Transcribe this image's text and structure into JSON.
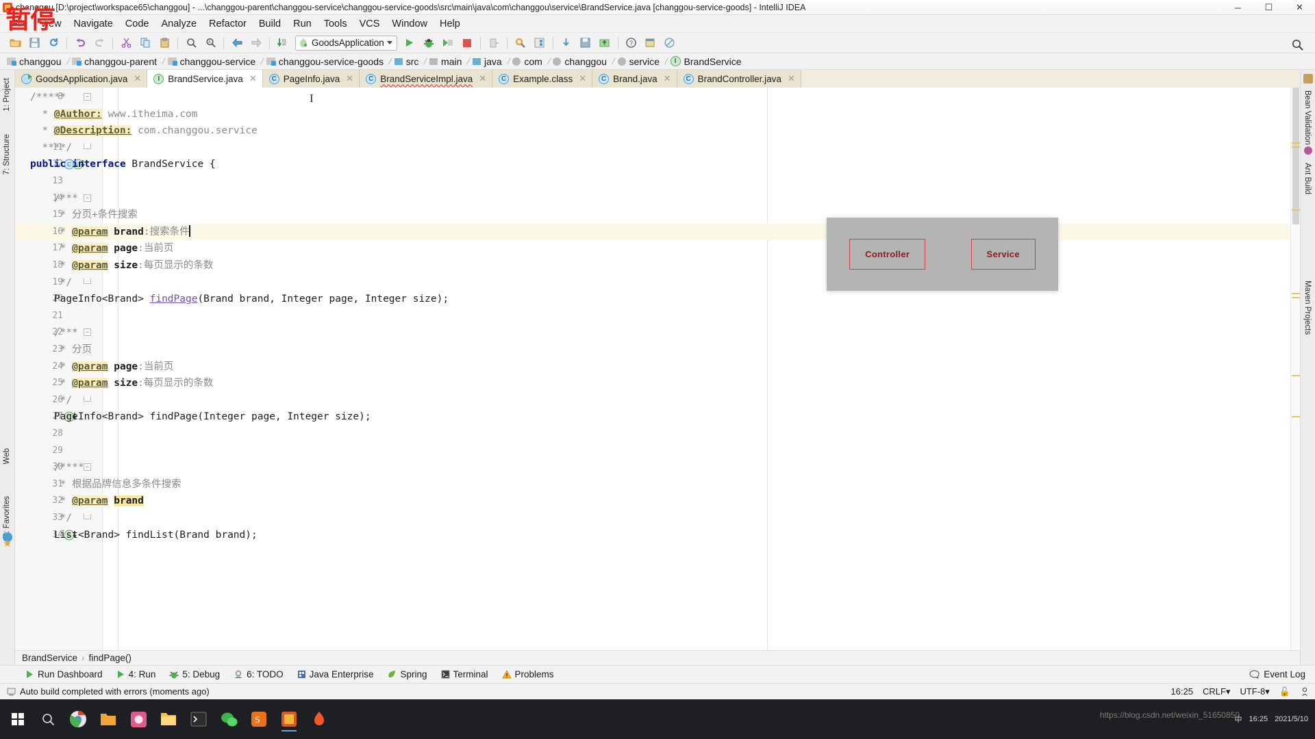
{
  "window": {
    "title": "changgou [D:\\project\\workspace65\\changgou] - ...\\changgou-parent\\changgou-service\\changgou-service-goods\\src\\main\\java\\com\\changgou\\service\\BrandService.java [changgou-service-goods] - IntelliJ IDEA",
    "minimize": "─",
    "maximize": "☐",
    "close": "✕",
    "watermark": "暂停",
    "bottom_watermark": "https://blog.csdn.net/weixin_51650850"
  },
  "menubar": {
    "items": [
      "File",
      "View",
      "Navigate",
      "Code",
      "Analyze",
      "Refactor",
      "Build",
      "Run",
      "Tools",
      "VCS",
      "Window",
      "Help"
    ]
  },
  "toolbar": {
    "open_label": "open-folder",
    "save_label": "save-all",
    "sync_label": "synchronize",
    "undo_label": "undo",
    "redo_label": "redo",
    "cut_label": "cut",
    "copy_label": "copy",
    "paste_label": "paste",
    "find_label": "find",
    "replace_label": "replace",
    "back_label": "back",
    "forward_label": "forward",
    "compile_label": "compile",
    "run_config": "GoodsApplication",
    "run_label": "Run",
    "debug_label": "Debug",
    "coverage_label": "Run with Coverage",
    "stop_label": "Stop",
    "exit_label": "exit",
    "settings_label": "Settings",
    "project_structure_label": "Project Structure",
    "update_label": "Update Project",
    "commit_label": "Commit",
    "push_label": "Push",
    "help_label": "Help",
    "search_label": "Search Everywhere"
  },
  "breadcrumb": {
    "items": [
      {
        "label": "changgou",
        "icon": "project-folder-icon"
      },
      {
        "label": "changgou-parent",
        "icon": "module-folder-icon"
      },
      {
        "label": "changgou-service",
        "icon": "module-folder-icon"
      },
      {
        "label": "changgou-service-goods",
        "icon": "module-folder-icon"
      },
      {
        "label": "src",
        "icon": "source-folder-icon"
      },
      {
        "label": "main",
        "icon": "folder-icon"
      },
      {
        "label": "java",
        "icon": "folder-icon"
      },
      {
        "label": "com",
        "icon": "package-icon"
      },
      {
        "label": "changgou",
        "icon": "package-icon"
      },
      {
        "label": "service",
        "icon": "package-icon"
      },
      {
        "label": "BrandService",
        "icon": "interface-icon"
      }
    ],
    "separator": "❯"
  },
  "tabs": [
    {
      "label": "GoodsApplication.java",
      "icon": "run-class-icon",
      "active": false,
      "error": false
    },
    {
      "label": "BrandService.java",
      "icon": "interface-icon",
      "active": true,
      "error": false
    },
    {
      "label": "PageInfo.java",
      "icon": "class-locked-icon",
      "active": false,
      "error": false
    },
    {
      "label": "BrandServiceImpl.java",
      "icon": "class-icon",
      "active": false,
      "error": true
    },
    {
      "label": "Example.class",
      "icon": "class-locked-icon",
      "active": false,
      "error": false
    },
    {
      "label": "Brand.java",
      "icon": "class-icon",
      "active": false,
      "error": false
    },
    {
      "label": "BrandController.java",
      "icon": "class-icon",
      "active": false,
      "error": false
    }
  ],
  "left_strip": [
    {
      "label": "1: Project",
      "icon": "project-icon"
    },
    {
      "label": "7: Structure",
      "icon": "structure-icon"
    },
    {
      "label": "Web",
      "icon": "web-icon"
    },
    {
      "label": "2: Favorites",
      "icon": "favorites-icon"
    }
  ],
  "right_strip": [
    {
      "label": "Bean Validation",
      "icon": "bean-icon"
    },
    {
      "label": "Ant Build",
      "icon": "ant-icon"
    },
    {
      "label": "Maven Projects",
      "icon": "maven-icon"
    }
  ],
  "editor": {
    "lines": [
      {
        "n": 8,
        "fold": "start",
        "html": "<span class='cmt'>/*****</span>"
      },
      {
        "n": 9,
        "html": "<span class='cmt'>  * </span><span class='tag'>@Author:</span><span class='tagv'> www.itheima.com</span>"
      },
      {
        "n": 10,
        "html": "<span class='cmt'>  * </span><span class='tag'>@Description:</span><span class='tagv'> com.changgou.service</span>"
      },
      {
        "n": 11,
        "fold": "end",
        "html": "<span class='cmt'>  ****/</span>"
      },
      {
        "n": 12,
        "gutter": "impl-marker",
        "html": "<span class='kw'>public interface</span> BrandService {"
      },
      {
        "n": 13,
        "html": ""
      },
      {
        "n": 14,
        "fold": "start",
        "html": "<span class='cmt'>    /***</span>"
      },
      {
        "n": 15,
        "html": "<span class='cmt'>     * 分页+条件搜索</span>"
      },
      {
        "n": 16,
        "highlight": true,
        "bulb": true,
        "caret": true,
        "html": "<span class='cmt'>     * </span><span class='tag'>@param</span> <span style='font-weight:bold'>brand</span><span class='cmt'>:搜索条件</span>"
      },
      {
        "n": 17,
        "html": "<span class='cmt'>     * </span><span class='tag'>@param</span> <span style='font-weight:bold'>page</span><span class='cmt'>:当前页</span>"
      },
      {
        "n": 18,
        "html": "<span class='cmt'>     * </span><span class='tag'>@param</span> <span style='font-weight:bold'>size</span><span class='cmt'>:每页显示的条数</span>"
      },
      {
        "n": 19,
        "fold": "end",
        "html": "<span class='cmt'>     */</span>"
      },
      {
        "n": 20,
        "html": "    PageInfo&lt;Brand&gt; <span class='mth'>findPage</span>(Brand brand, Integer page, Integer size);"
      },
      {
        "n": 21,
        "html": ""
      },
      {
        "n": 22,
        "fold": "start",
        "html": "<span class='cmt'>    /***</span>"
      },
      {
        "n": 23,
        "html": "<span class='cmt'>     * 分页</span>"
      },
      {
        "n": 24,
        "html": "<span class='cmt'>     * </span><span class='tag'>@param</span> <span style='font-weight:bold'>page</span><span class='cmt'>:当前页</span>"
      },
      {
        "n": 25,
        "html": "<span class='cmt'>     * </span><span class='tag'>@param</span> <span style='font-weight:bold'>size</span><span class='cmt'>:每页显示的条数</span>"
      },
      {
        "n": 26,
        "fold": "end",
        "html": "<span class='cmt'>     */</span>"
      },
      {
        "n": 27,
        "gutter": "impl-marker",
        "html": "    PageInfo&lt;Brand&gt; findPage(Integer page, Integer size);"
      },
      {
        "n": 28,
        "html": ""
      },
      {
        "n": 29,
        "html": ""
      },
      {
        "n": 30,
        "fold": "start",
        "html": "<span class='cmt'>    /****</span>"
      },
      {
        "n": 31,
        "html": "<span class='cmt'>     * 根据品牌信息多条件搜索</span>"
      },
      {
        "n": 32,
        "html": "<span class='cmt'>     * </span><span class='tag'>@param</span> <span class='hlword' style='font-weight:bold'>brand</span>"
      },
      {
        "n": 33,
        "fold": "end",
        "html": "<span class='cmt'>     */</span>"
      },
      {
        "n": 34,
        "gutter": "impl-marker",
        "html": "    List&lt;Brand&gt; findList(Brand brand);"
      }
    ]
  },
  "overlay": {
    "boxes": [
      "Controller",
      "Service"
    ],
    "accent": "#d04040",
    "background": "#b4b4b4"
  },
  "nav_footer": {
    "class": "BrandService",
    "member": "findPage()",
    "separator": "›"
  },
  "tool_windows": [
    {
      "label": "Run Dashboard",
      "icon": "run-dashboard-icon"
    },
    {
      "label": "4: Run",
      "icon": "run-icon"
    },
    {
      "label": "5: Debug",
      "icon": "debug-icon"
    },
    {
      "label": "6: TODO",
      "icon": "todo-icon"
    },
    {
      "label": "Java Enterprise",
      "icon": "java-enterprise-icon"
    },
    {
      "label": "Spring",
      "icon": "spring-icon"
    },
    {
      "label": "Terminal",
      "icon": "terminal-icon"
    },
    {
      "label": "Problems",
      "icon": "problems-icon"
    }
  ],
  "event_log": {
    "label": "Event Log",
    "icon": "balloon-icon"
  },
  "statusbar": {
    "message": "Auto build completed with errors (moments ago)",
    "time": "16:25",
    "line_separator": "CRLF",
    "encoding": "UTF-8",
    "lock_icon": "lock-icon",
    "inspection_icon": "inspector-icon"
  },
  "taskbar": {
    "start_icon": "windows-start-icon",
    "search_icon": "search-circle-icon",
    "apps": [
      {
        "name": "chrome-taskbar-icon",
        "color": "#e8e8e8"
      },
      {
        "name": "folder-orange-taskbar-icon",
        "color": "#f0a43a"
      },
      {
        "name": "photos-taskbar-icon",
        "color": "#e05a8a"
      },
      {
        "name": "explorer-taskbar-icon",
        "color": "#f5c24a"
      },
      {
        "name": "terminal-taskbar-icon",
        "color": "#3a3a3a"
      },
      {
        "name": "wechat-taskbar-icon",
        "color": "#3ab44a"
      },
      {
        "name": "sogou-taskbar-icon",
        "color": "#e8731c"
      },
      {
        "name": "idea-taskbar-icon",
        "color": "#d85a28"
      },
      {
        "name": "flame-taskbar-icon",
        "color": "#f05a28"
      }
    ],
    "tray_ime": "中",
    "tray_time": "16:25",
    "tray_date": "2021/5/10"
  }
}
